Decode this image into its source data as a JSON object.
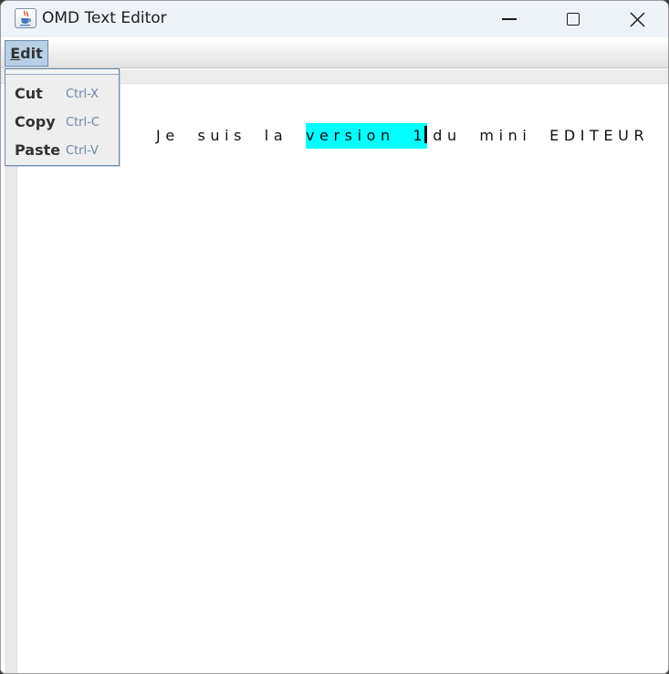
{
  "window": {
    "title": "OMD Text Editor",
    "icon": "java-coffee-cup-icon"
  },
  "title_controls": {
    "minimize_icon": "minimize-icon",
    "maximize_icon": "maximize-icon",
    "close_icon": "close-icon"
  },
  "menubar": {
    "items": [
      {
        "label": "Edit",
        "mnemonic": "E",
        "rest": "dit",
        "state": "open"
      }
    ]
  },
  "edit_menu": {
    "items": [
      {
        "label": "Cut",
        "accelerator": "Ctrl-X"
      },
      {
        "label": "Copy",
        "accelerator": "Ctrl-C"
      },
      {
        "label": "Paste",
        "accelerator": "Ctrl-V"
      }
    ]
  },
  "editor": {
    "before_selection": "Je suis la ",
    "selection": "version 1",
    "after_selection": "du mini EDITEUR",
    "selection_color": "#00ffff"
  }
}
